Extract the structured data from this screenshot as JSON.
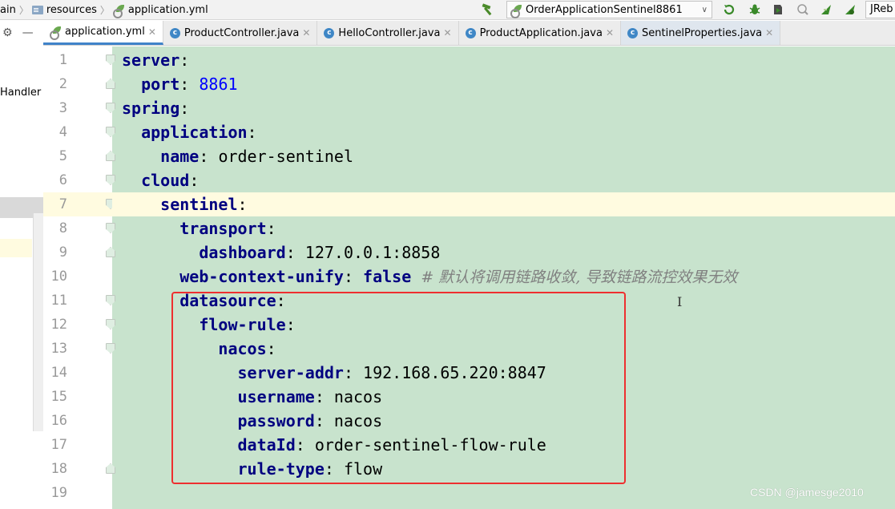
{
  "navbar": {
    "breadcrumbs": [
      "ain",
      "resources",
      "application.yml"
    ],
    "run_config": "OrderApplicationSentinel8861",
    "jrebel_label": "JReb",
    "icons": [
      "hammer-icon",
      "rerun-icon",
      "debug-icon",
      "coverage-icon",
      "profile-icon",
      "jrebel-run-icon",
      "jrebel-debug-icon"
    ]
  },
  "project_panel": {
    "tool_icons": [
      "settings-icon",
      "collapse-icon"
    ],
    "visible_text": "Handler"
  },
  "tabs": [
    {
      "label": "application.yml",
      "icon": "yml-icon",
      "active": true
    },
    {
      "label": "ProductController.java",
      "icon": "class-icon",
      "active": false
    },
    {
      "label": "HelloController.java",
      "icon": "class-icon",
      "active": false
    },
    {
      "label": "ProductApplication.java",
      "icon": "class-run-icon",
      "active": false
    },
    {
      "label": "SentinelProperties.java",
      "icon": "class-icon",
      "active": false
    }
  ],
  "editor": {
    "current_line": 7,
    "lines": [
      {
        "num": "1",
        "indent": "",
        "key": "server",
        "sep": ":",
        "value": "",
        "value_type": "none",
        "comment": ""
      },
      {
        "num": "2",
        "indent": "  ",
        "key": "port",
        "sep": ": ",
        "value": "8861",
        "value_type": "number",
        "comment": ""
      },
      {
        "num": "3",
        "indent": "",
        "key": "spring",
        "sep": ":",
        "value": "",
        "value_type": "none",
        "comment": ""
      },
      {
        "num": "4",
        "indent": "  ",
        "key": "application",
        "sep": ":",
        "value": "",
        "value_type": "none",
        "comment": ""
      },
      {
        "num": "5",
        "indent": "    ",
        "key": "name",
        "sep": ": ",
        "value": "order-sentinel",
        "value_type": "string",
        "comment": ""
      },
      {
        "num": "6",
        "indent": "  ",
        "key": "cloud",
        "sep": ":",
        "value": "",
        "value_type": "none",
        "comment": ""
      },
      {
        "num": "7",
        "indent": "    ",
        "key": "sentinel",
        "sep": ":",
        "value": "",
        "value_type": "none",
        "comment": ""
      },
      {
        "num": "8",
        "indent": "      ",
        "key": "transport",
        "sep": ":",
        "value": "",
        "value_type": "none",
        "comment": ""
      },
      {
        "num": "9",
        "indent": "        ",
        "key": "dashboard",
        "sep": ": ",
        "value": "127.0.0.1:8858",
        "value_type": "string",
        "comment": ""
      },
      {
        "num": "10",
        "indent": "      ",
        "key": "web-context-unify",
        "sep": ": ",
        "value": "false",
        "value_type": "keyword",
        "comment": "  # 默认将调用链路收敛, 导致链路流控效果无效"
      },
      {
        "num": "11",
        "indent": "      ",
        "key": "datasource",
        "sep": ":",
        "value": "",
        "value_type": "none",
        "comment": ""
      },
      {
        "num": "12",
        "indent": "        ",
        "key": "flow-rule",
        "sep": ":",
        "value": "",
        "value_type": "none",
        "comment": ""
      },
      {
        "num": "13",
        "indent": "          ",
        "key": "nacos",
        "sep": ":",
        "value": "",
        "value_type": "none",
        "comment": ""
      },
      {
        "num": "14",
        "indent": "            ",
        "key": "server-addr",
        "sep": ": ",
        "value": "192.168.65.220:8847",
        "value_type": "string",
        "comment": ""
      },
      {
        "num": "15",
        "indent": "            ",
        "key": "username",
        "sep": ": ",
        "value": "nacos",
        "value_type": "string",
        "comment": ""
      },
      {
        "num": "16",
        "indent": "            ",
        "key": "password",
        "sep": ": ",
        "value": "nacos",
        "value_type": "string",
        "comment": ""
      },
      {
        "num": "17",
        "indent": "            ",
        "key": "dataId",
        "sep": ": ",
        "value": "order-sentinel-flow-rule",
        "value_type": "string",
        "comment": ""
      },
      {
        "num": "18",
        "indent": "            ",
        "key": "rule-type",
        "sep": ": ",
        "value": "flow",
        "value_type": "string",
        "comment": ""
      },
      {
        "num": "19",
        "indent": "",
        "key": "",
        "sep": "",
        "value": "",
        "value_type": "none",
        "comment": ""
      }
    ],
    "fold_starts": [
      1,
      3,
      4,
      6,
      7,
      8,
      11,
      12,
      13
    ],
    "fold_ends": [
      2,
      5,
      9,
      18
    ]
  },
  "watermark": "CSDN @jamesge2010",
  "colors": {
    "code_background": "#c8e3cd",
    "current_line": "#fffbe0",
    "key_color": "#000080",
    "number_color": "#0000ff",
    "comment_color": "#808080",
    "highlight_box": "#ee2f2f",
    "active_tab_underline": "#4083c9"
  }
}
